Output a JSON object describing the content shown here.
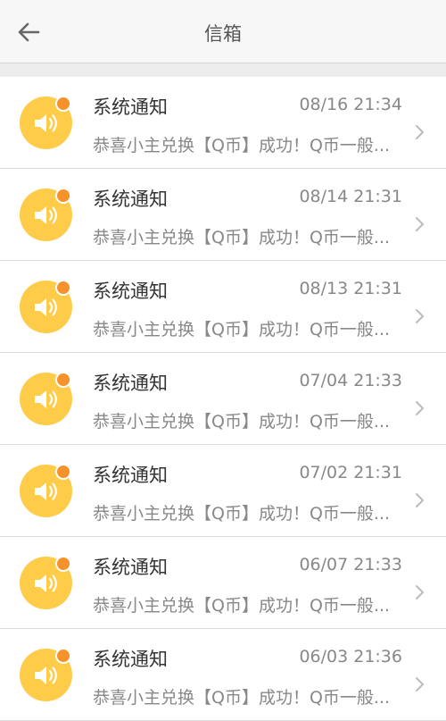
{
  "header": {
    "title": "信箱"
  },
  "icons": {
    "back": "arrow-left-icon",
    "avatar": "speaker-icon",
    "unread": "unread-dot-icon",
    "chevron": "chevron-right-icon"
  },
  "colors": {
    "avatar_bg": "#ffcc4a",
    "unread_dot": "#f5922a",
    "header_bg": "#f7f7f7"
  },
  "messages": [
    {
      "title": "系统通知",
      "time": "08/16 21:34",
      "preview": "恭喜小主兑换【Q币】成功！Q币一般..."
    },
    {
      "title": "系统通知",
      "time": "08/14 21:31",
      "preview": "恭喜小主兑换【Q币】成功！Q币一般..."
    },
    {
      "title": "系统通知",
      "time": "08/13 21:31",
      "preview": "恭喜小主兑换【Q币】成功！Q币一般..."
    },
    {
      "title": "系统通知",
      "time": "07/04 21:33",
      "preview": "恭喜小主兑换【Q币】成功！Q币一般..."
    },
    {
      "title": "系统通知",
      "time": "07/02 21:31",
      "preview": "恭喜小主兑换【Q币】成功！Q币一般..."
    },
    {
      "title": "系统通知",
      "time": "06/07 21:33",
      "preview": "恭喜小主兑换【Q币】成功！Q币一般..."
    },
    {
      "title": "系统通知",
      "time": "06/03 21:36",
      "preview": "恭喜小主兑换【Q币】成功！Q币一般..."
    }
  ]
}
